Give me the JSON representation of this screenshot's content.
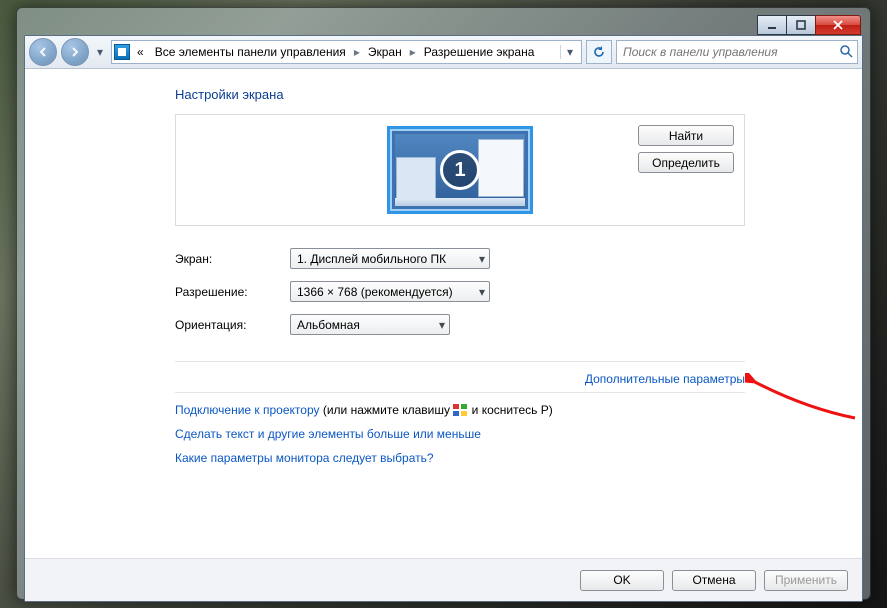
{
  "titlebar": {
    "min": "",
    "max": "",
    "close": ""
  },
  "breadcrumb": {
    "prefix": "«",
    "items": [
      "Все элементы панели управления",
      "Экран",
      "Разрешение экрана"
    ]
  },
  "search": {
    "placeholder": "Поиск в панели управления"
  },
  "heading": "Настройки экрана",
  "sideButtons": {
    "detect": "Найти",
    "identify": "Определить"
  },
  "monitorNumber": "1",
  "form": {
    "display": {
      "label": "Экран:",
      "value": "1. Дисплей мобильного ПК"
    },
    "res": {
      "label": "Разрешение:",
      "value": "1366 × 768 (рекомендуется)"
    },
    "orient": {
      "label": "Ориентация:",
      "value": "Альбомная"
    }
  },
  "advancedLink": "Дополнительные параметры",
  "projector": {
    "link": "Подключение к проектору",
    "suffix1": " (или нажмите клавишу ",
    "suffix2": " и коснитесь P)"
  },
  "link2": "Сделать текст и другие элементы больше или меньше",
  "link3": "Какие параметры монитора следует выбрать?",
  "footer": {
    "ok": "OK",
    "cancel": "Отмена",
    "apply": "Применить"
  }
}
